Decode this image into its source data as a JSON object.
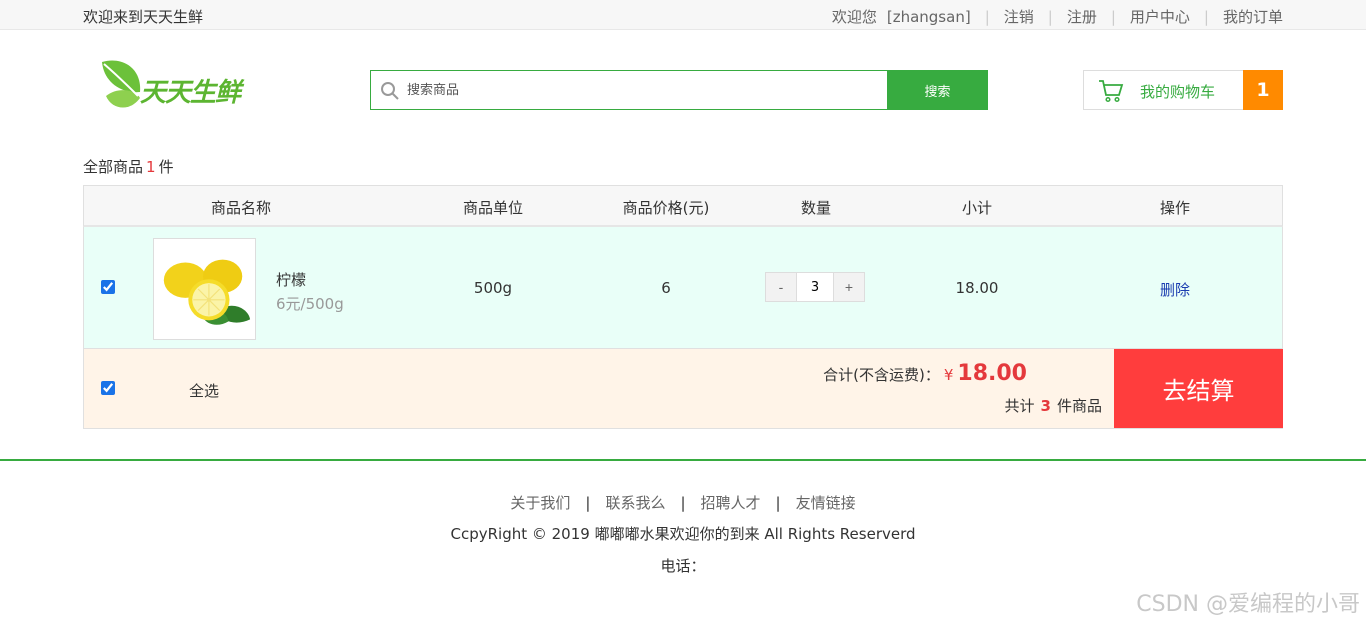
{
  "topbar": {
    "welcome": "欢迎来到天天生鲜",
    "greeting": "欢迎您",
    "username": "[zhangsan]",
    "links": [
      "注销",
      "注册",
      "用户中心",
      "我的订单"
    ]
  },
  "logo": {
    "text": "天天生鲜"
  },
  "search": {
    "placeholder": "搜索商品",
    "button": "搜索"
  },
  "cart": {
    "label": "我的购物车",
    "count": "1"
  },
  "summary": {
    "prefix": "全部商品",
    "count": "1",
    "suffix": "件"
  },
  "table": {
    "headers": [
      "商品名称",
      "商品单位",
      "商品价格(元)",
      "数量",
      "小计",
      "操作"
    ],
    "rows": [
      {
        "name": "柠檬",
        "unit_price": "6元/500g",
        "unit": "500g",
        "price": "6",
        "quantity": "3",
        "subtotal": "18.00",
        "action": "删除",
        "checked": true
      }
    ],
    "qty_minus": "-",
    "qty_plus": "+"
  },
  "footer_bar": {
    "select_all": "全选",
    "total_label": "合计(不含运费)：",
    "currency": "¥",
    "total": "18.00",
    "count_prefix": "共计",
    "count": "3",
    "count_suffix": "件商品",
    "checkout": "去结算"
  },
  "footer": {
    "links": [
      "关于我们",
      "联系我么",
      "招聘人才",
      "友情链接"
    ],
    "copyright": "CcpyRight © 2019 嘟嘟嘟水果欢迎你的到来 All Rights Reserverd",
    "phone": "电话："
  },
  "watermark": "CSDN @爱编程的小哥",
  "colors": {
    "brand_green": "#37ab40",
    "cart_badge": "#ff8a00",
    "checkout_red": "#ff3d3d",
    "price_red": "#e4393c"
  }
}
